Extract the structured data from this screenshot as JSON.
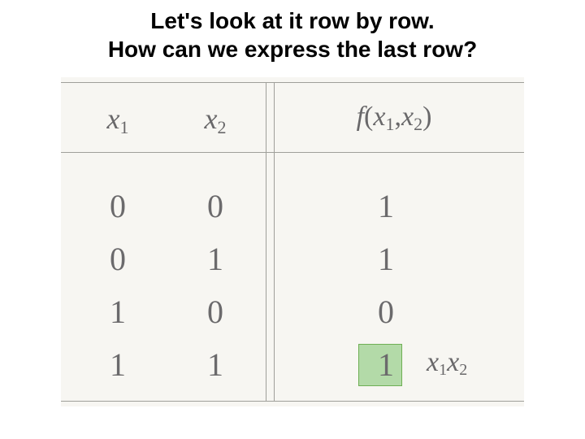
{
  "title_line1": "Let's look at it row by row.",
  "title_line2": "How can we express the last row?",
  "headers": {
    "x1": "x",
    "x1_sub": "1",
    "x2": "x",
    "x2_sub": "2",
    "f_prefix": "f",
    "f_open": "(",
    "f_arg1": "x",
    "f_arg1_sub": "1",
    "f_comma": ",",
    "f_arg2": "x",
    "f_arg2_sub": "2",
    "f_close": ")"
  },
  "rows": [
    {
      "x1": "0",
      "x2": "0",
      "f": "1"
    },
    {
      "x1": "0",
      "x2": "1",
      "f": "1"
    },
    {
      "x1": "1",
      "x2": "0",
      "f": "0"
    },
    {
      "x1": "1",
      "x2": "1",
      "f": "1"
    }
  ],
  "annotation": {
    "a": "x",
    "a_sub": "1",
    "b": "x",
    "b_sub": "2"
  },
  "chart_data": {
    "type": "table",
    "title": "Truth table with last-row minterm highlighted",
    "columns": [
      "x1",
      "x2",
      "f(x1,x2)"
    ],
    "rows": [
      [
        0,
        0,
        1
      ],
      [
        0,
        1,
        1
      ],
      [
        1,
        0,
        0
      ],
      [
        1,
        1,
        1
      ]
    ],
    "highlight": {
      "row": 3,
      "col": 2
    },
    "annotation_last_row": "x1 x2"
  }
}
